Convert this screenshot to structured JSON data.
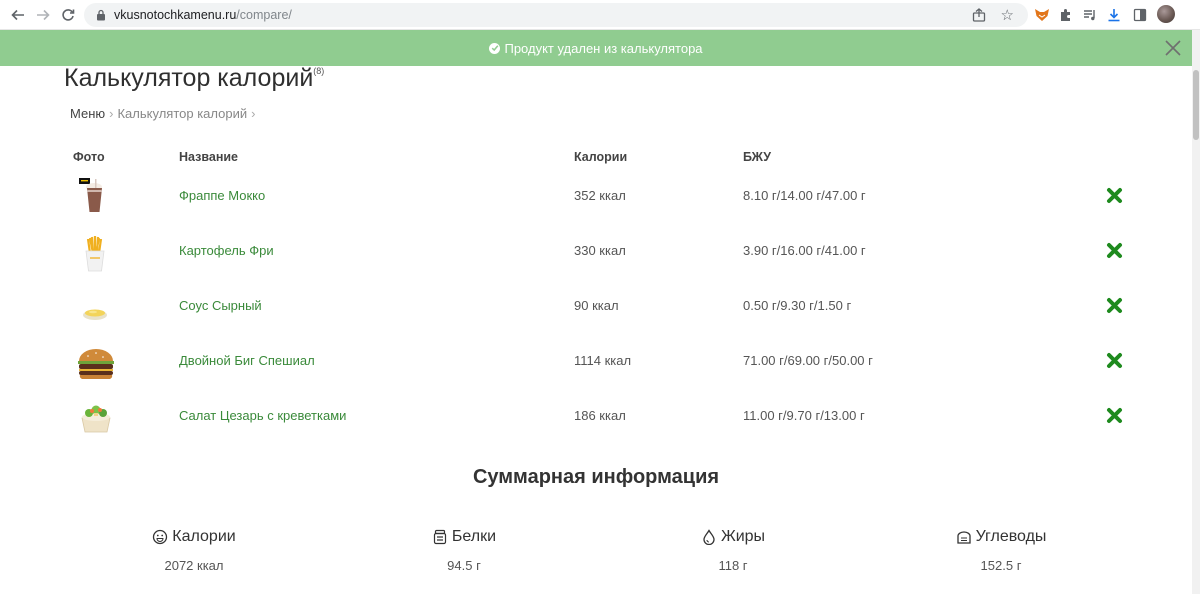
{
  "browser": {
    "url_domain": "vkusnotochkamenu.ru",
    "url_path": "/compare/"
  },
  "notice": {
    "text": "Продукт удален из калькулятора"
  },
  "page": {
    "title": "Калькулятор калорий",
    "title_badge": "(8)",
    "breadcrumb": [
      "Меню",
      "Калькулятор калорий"
    ],
    "breadcrumb_separator": "›"
  },
  "table": {
    "headers": {
      "photo": "Фото",
      "name": "Название",
      "calories": "Калории",
      "bju": "БЖУ"
    },
    "rows": [
      {
        "name": "Фраппе Мокко",
        "calories": "352 ккал",
        "bju": "8.10 г/14.00 г/47.00 г",
        "photo_icon": "frappe-mocha-icon"
      },
      {
        "name": "Картофель Фри",
        "calories": "330 ккал",
        "bju": "3.90 г/16.00 г/41.00 г",
        "photo_icon": "french-fries-icon"
      },
      {
        "name": "Соус Сырный",
        "calories": "90 ккал",
        "bju": "0.50 г/9.30 г/1.50 г",
        "photo_icon": "cheese-sauce-icon"
      },
      {
        "name": "Двойной Биг Спешиал",
        "calories": "1114 ккал",
        "bju": "71.00 г/69.00 г/50.00 г",
        "photo_icon": "burger-icon"
      },
      {
        "name": "Салат Цезарь с креветками",
        "calories": "186 ккал",
        "bju": "11.00 г/9.70 г/13.00 г",
        "photo_icon": "salad-icon"
      }
    ]
  },
  "summary": {
    "title": "Суммарная информация",
    "calories": {
      "label": "Калории",
      "value": "2072 ккал"
    },
    "proteins": {
      "label": "Белки",
      "value": "94.5 г"
    },
    "fats": {
      "label": "Жиры",
      "value": "118 г"
    },
    "carbs": {
      "label": "Углеводы",
      "value": "152.5 г"
    }
  },
  "colors": {
    "notice_bg": "#90cc90",
    "link_green": "#3a8a3a",
    "delete_green": "#1e8a1e"
  }
}
